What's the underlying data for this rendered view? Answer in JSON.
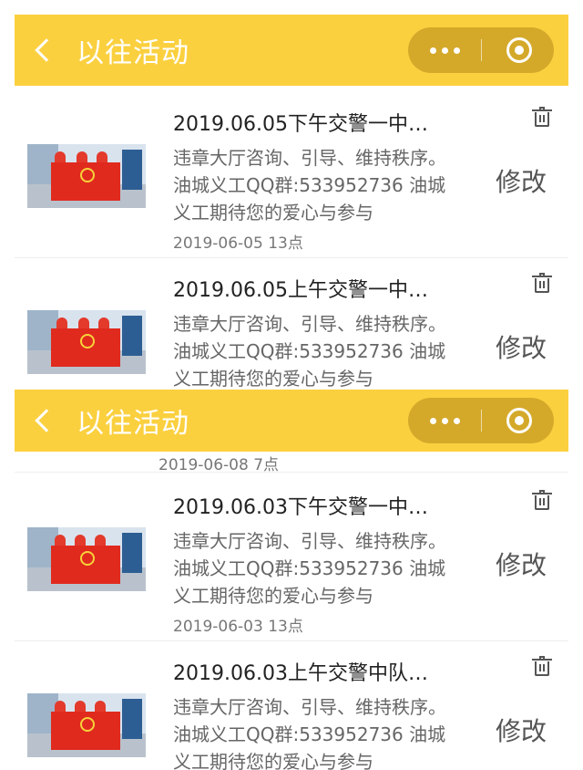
{
  "navbar": {
    "title": "以往活动"
  },
  "top_cards": [
    {
      "title": "2019.06.05下午交警一中…",
      "description": "违章大厅咨询、引导、维持秩序。油城义工QQ群:533952736 油城义工期待您的爱心与参与",
      "date": "2019-06-05 13点",
      "edit_label": "修改"
    },
    {
      "title": "2019.06.05上午交警一中…",
      "description": "违章大厅咨询、引导、维持秩序。油城义工QQ群:533952736 油城义工期待您的爱心与参与",
      "edit_label": "修改"
    }
  ],
  "partial_date": "2019-06-08 7点",
  "bottom_cards": [
    {
      "title": "2019.06.03下午交警一中…",
      "description": "违章大厅咨询、引导、维持秩序。油城义工QQ群:533952736 油城义工期待您的爱心与参与",
      "date": "2019-06-03 13点",
      "edit_label": "修改"
    },
    {
      "title": "2019.06.03上午交警中队…",
      "description": "违章大厅咨询、引导、维持秩序。油城义工QQ群:533952736 油城义工期待您的爱心与参与",
      "edit_label": "修改"
    }
  ],
  "colors": {
    "navbar": "#fbd03f",
    "capsule": "#d4a92a",
    "flag": "#e02a1e"
  },
  "icons": {
    "back": "back-arrow-icon",
    "more": "more-dots-icon",
    "close": "target-circle-icon",
    "delete": "trash-icon"
  }
}
